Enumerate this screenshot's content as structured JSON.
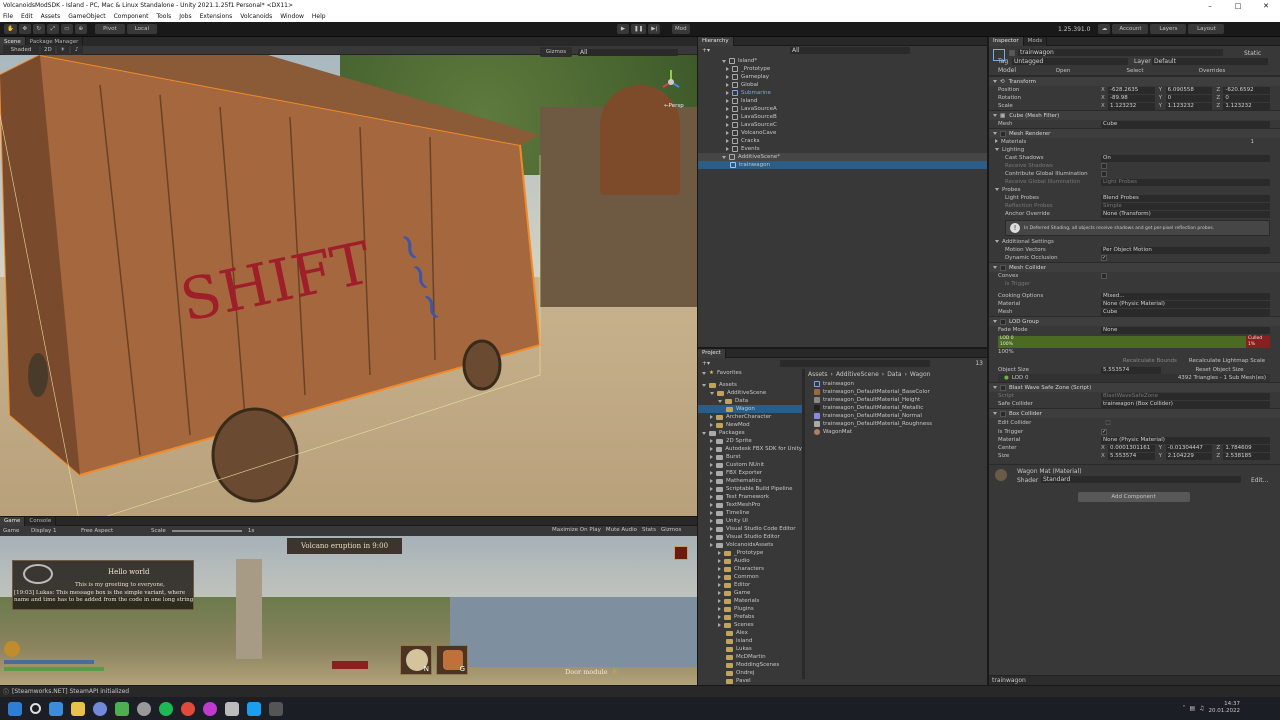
{
  "window": {
    "title": "VolcanoidsModSDK - Island - PC, Mac & Linux Standalone - Unity 2021.1.25f1 Personal* <DX11>",
    "controls": [
      "–",
      "□",
      "✕"
    ]
  },
  "menu": [
    "File",
    "Edit",
    "Assets",
    "GameObject",
    "Component",
    "Tools",
    "Jobs",
    "Extensions",
    "Volcanoids",
    "Window",
    "Help"
  ],
  "toolbar": {
    "pivot": "Pivot",
    "local": "Local",
    "mod": "Mod",
    "version": "1.25.391.0",
    "account": "Account",
    "layers": "Layers",
    "layout": "Layout"
  },
  "scene": {
    "tabs": [
      "Scene",
      "Package Manager"
    ],
    "shading": "Shaded",
    "mode": "2D",
    "gizmos": "Gizmos",
    "search": "All",
    "persp": "←Persp",
    "graffiti": "SHIFT"
  },
  "game": {
    "tabs": [
      "Game",
      "Console"
    ],
    "display": "Display 1",
    "aspect": "Free Aspect",
    "scale_label": "Scale",
    "scale_value": "1x",
    "options": [
      "Maximize On Play",
      "Mute Audio",
      "Stats",
      "Gizmos"
    ],
    "eruption": "Volcano eruption in 9:00",
    "greeting_title": "Hello world",
    "greeting_line1": "This is my greeting to everyone,",
    "chat": "[19:03] Lukas: This message box is the simple variant, where name and time has to be added from the code in one long string",
    "door": "Door module",
    "door_key": "E",
    "hotbar_keys": [
      "N",
      "G"
    ]
  },
  "hierarchy": {
    "tab": "Hierarchy",
    "search": "All",
    "root": "Island*",
    "items": [
      "_Prototype",
      "Gameplay",
      "Global",
      "Submarine",
      "Island",
      "LavaSourceA",
      "LavaSourceB",
      "LavaSourceC",
      "VolcanoCave",
      "Cracks",
      "Events"
    ],
    "additive": "AdditiveScene*",
    "additive_child": "trainwagon"
  },
  "project": {
    "tab": "Project",
    "favorites": "Favorites",
    "assets": "Assets",
    "tree": [
      {
        "name": "AdditiveScene",
        "level": 1
      },
      {
        "name": "Data",
        "level": 2
      },
      {
        "name": "Wagon",
        "level": 3,
        "selected": true
      },
      {
        "name": "ArcherCharacter",
        "level": 1
      },
      {
        "name": "NewMod",
        "level": 1
      }
    ],
    "packages": "Packages",
    "package_list": [
      "2D Sprite",
      "Autodesk FBX SDK for Unity",
      "Burst",
      "Custom NUnit",
      "FBX Exporter",
      "Mathematics",
      "Scriptable Build Pipeline",
      "Test Framework",
      "TextMeshPro",
      "Timeline",
      "Unity UI",
      "Visual Studio Code Editor",
      "Visual Studio Editor",
      "VolcanoidsAssets"
    ],
    "volcanoids_children": [
      "_Prototype",
      "Audio",
      "Characters",
      "Common",
      "Editor",
      "Game",
      "Materials",
      "Plugins",
      "Prefabs",
      "Scenes"
    ],
    "scene_children": [
      "Alex",
      "Island",
      "Lukas",
      "McDMartin",
      "ModdingScenes",
      "Ondrej",
      "Pavel"
    ],
    "breadcrumb": [
      "Assets",
      "AdditiveScene",
      "Data",
      "Wagon"
    ],
    "files": [
      "trainwagon",
      "trainwagon_DefaultMaterial_BaseColor",
      "trainwagon_DefaultMaterial_Height",
      "trainwagon_DefaultMaterial_Metallic",
      "trainwagon_DefaultMaterial_Normal",
      "trainwagon_DefaultMaterial_Roughness",
      "WagonMat"
    ],
    "count": "13"
  },
  "inspector": {
    "tabs": [
      "Inspector",
      "Mods"
    ],
    "object_name": "trainwagon",
    "static": "Static",
    "tag_label": "Tag",
    "tag": "Untagged",
    "layer_label": "Layer",
    "layer": "Default",
    "model_label": "Model",
    "open": "Open",
    "select": "Select",
    "overrides": "Overrides",
    "transform": {
      "title": "Transform",
      "position": [
        "-628.2635",
        "6.090558",
        "-620.6592"
      ],
      "rotation": [
        "-89.98",
        "0",
        "0"
      ],
      "scale": [
        "1.123232",
        "1.123232",
        "1.123232"
      ],
      "labels": [
        "Position",
        "Rotation",
        "Scale"
      ]
    },
    "mesh_filter": {
      "title": "Cube (Mesh Filter)",
      "mesh_label": "Mesh",
      "mesh": "Cube"
    },
    "mesh_renderer": {
      "title": "Mesh Renderer",
      "materials": "Materials",
      "materials_count": "1",
      "lighting": "Lighting",
      "cast_shadows_label": "Cast Shadows",
      "cast_shadows": "On",
      "receive_shadows": "Receive Shadows",
      "contribute_gi": "Contribute Global Illumination",
      "receive_gi_label": "Receive Global Illumination",
      "receive_gi": "Light Probes",
      "probes": "Probes",
      "light_probes_label": "Light Probes",
      "light_probes": "Blend Probes",
      "reflection_probes_label": "Reflection Probes",
      "reflection_probes": "Simple",
      "anchor_label": "Anchor Override",
      "anchor": "None (Transform)",
      "info": "In Deferred Shading, all objects receive shadows and get per-pixel reflection probes.",
      "additional": "Additional Settings",
      "motion_label": "Motion Vectors",
      "motion": "Per Object Motion",
      "occlusion": "Dynamic Occlusion"
    },
    "mesh_collider": {
      "title": "Mesh Collider",
      "convex": "Convex",
      "trigger": "Is Trigger",
      "cooking_label": "Cooking Options",
      "cooking": "Mixed...",
      "material_label": "Material",
      "material": "None (Physic Material)",
      "mesh_label": "Mesh",
      "mesh": "Cube"
    },
    "lod_group": {
      "title": "LOD Group",
      "fade_label": "Fade Mode",
      "fade": "None",
      "lod0": "LOD 0",
      "lod0_pct": "100%",
      "culled": "Culled",
      "culled_pct": "1%",
      "bottom_pct": "100%",
      "recalc_bounds": "Recalculate Bounds",
      "recalc_lightmap": "Recalculate Lightmap Scale",
      "size_label": "Object Size",
      "size": "5.553574",
      "reset": "Reset Object Size",
      "lod_row": "LOD 0",
      "lod_info": "4392 Triangles - 1 Sub Mesh(es)"
    },
    "blast": {
      "title": "Blast Wave Safe Zone (Script)",
      "script_label": "Script",
      "script": "BlastWaveSafeZone",
      "collider_label": "Safe Collider",
      "collider": "trainwagon (Box Collider)"
    },
    "box_collider": {
      "title": "Box Collider",
      "edit": "Edit Collider",
      "trigger": "Is Trigger",
      "material_label": "Material",
      "material": "None (Physic Material)",
      "center_label": "Center",
      "center": [
        "0.0001301161",
        "-0.01304447",
        "1.784609"
      ],
      "size_label": "Size",
      "size": [
        "5.553574",
        "2.104229",
        "2.538185"
      ]
    },
    "material": {
      "title": "Wagon Mat (Material)",
      "shader_label": "Shader",
      "shader": "Standard",
      "edit": "Edit..."
    },
    "add_component": "Add Component",
    "footer": "trainwagon"
  },
  "status": {
    "message": "[Steamworks.NET] SteamAPI initialized"
  },
  "taskbar": {
    "time": "14:37",
    "date": "20.01.2022"
  }
}
